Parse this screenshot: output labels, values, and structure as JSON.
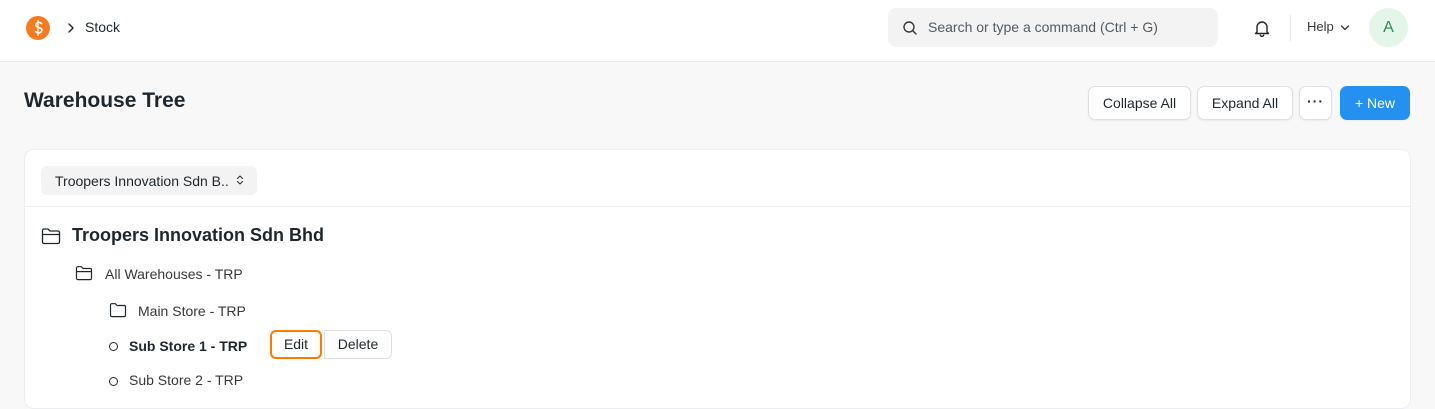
{
  "navbar": {
    "breadcrumb": "Stock",
    "search_placeholder": "Search or type a command (Ctrl + G)",
    "help_label": "Help",
    "avatar_initial": "A"
  },
  "page": {
    "title": "Warehouse Tree"
  },
  "toolbar": {
    "collapse_all": "Collapse All",
    "expand_all": "Expand All",
    "more": "···",
    "new": "+ New"
  },
  "filter": {
    "company": "Troopers Innovation Sdn B.."
  },
  "tree": {
    "root": "Troopers Innovation Sdn Bhd",
    "group": "All Warehouses - TRP",
    "nodes": [
      {
        "label": "Main Store - TRP",
        "type": "folder"
      },
      {
        "label": "Sub Store 1 - TRP",
        "type": "leaf",
        "selected": true
      },
      {
        "label": "Sub Store 2 - TRP",
        "type": "leaf"
      }
    ],
    "actions": {
      "edit": "Edit",
      "delete": "Delete"
    }
  },
  "colors": {
    "primary": "#2490ef",
    "logo": "#f47c20",
    "highlight": "#ff7a00"
  }
}
